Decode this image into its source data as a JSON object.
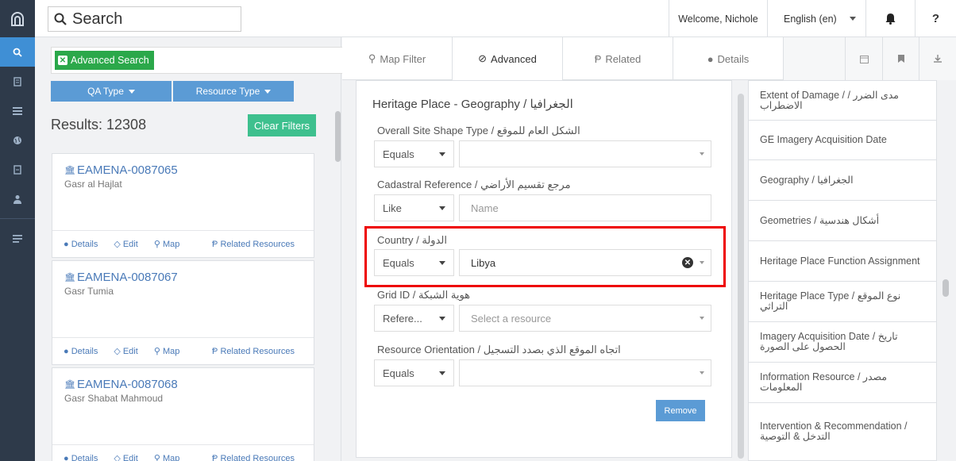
{
  "topbar": {
    "search_label": "Search",
    "welcome": "Welcome, Nichole",
    "language": "English (en)",
    "help": "?"
  },
  "sidebar": {
    "items": [
      "search",
      "bookmark",
      "list",
      "globe",
      "file",
      "user",
      "menu"
    ]
  },
  "search": {
    "advanced_tag": "Advanced Search",
    "filters": [
      "QA Type",
      "Resource Type"
    ],
    "results_label": "Results: 12308",
    "clear_filters": "Clear Filters"
  },
  "results": [
    {
      "id": "EAMENA-0087065",
      "name": "Gasr al Hajlat"
    },
    {
      "id": "EAMENA-0087067",
      "name": "Gasr Tumia"
    },
    {
      "id": "EAMENA-0087068",
      "name": "Gasr Shabat Mahmoud"
    }
  ],
  "result_links": {
    "details": "Details",
    "edit": "Edit",
    "map": "Map",
    "related": "Related Resources"
  },
  "tabs": [
    "Map Filter",
    "Advanced",
    "Related",
    "Details"
  ],
  "panel": {
    "title": "Heritage Place - Geography / الجغرافيا",
    "remove": "Remove",
    "fields": [
      {
        "label": "Overall Site Shape Type / الشكل العام للموقع",
        "op": "Equals",
        "value": "",
        "placeholder": ""
      },
      {
        "label": "Cadastral Reference / مرجع تقسيم الأراضي",
        "op": "Like",
        "value": "",
        "placeholder": "Name"
      },
      {
        "label": "Country / الدولة",
        "op": "Equals",
        "value": "Libya",
        "placeholder": ""
      },
      {
        "label": "Grid ID / هوية الشبكة",
        "op": "Refere...",
        "value": "",
        "placeholder": "Select a resource"
      },
      {
        "label": "Resource Orientation / اتجاه الموقع الذي بصدد التسجيل",
        "op": "Equals",
        "value": "",
        "placeholder": ""
      }
    ]
  },
  "card_list": [
    "Extent of Damage / مدى الضرر / الاضطراب",
    "GE Imagery Acquisition Date",
    "Geography / الجغرافيا",
    "Geometries / أشكال هندسية",
    "Heritage Place Function Assignment",
    "Heritage Place Type / نوع الموقع التراثي",
    "Imagery Acquisition Date / تاريخ الحصول على الصورة",
    "Information Resource / مصدر المعلومات",
    "Intervention & Recommendation / التدخل & التوصية"
  ],
  "colors": {
    "rail": "#2e3a4a",
    "accent": "#5b9bd5",
    "green": "#2ba84a",
    "teal": "#3ec08e",
    "link": "#4a7ab8",
    "highlight": "#e00000"
  }
}
